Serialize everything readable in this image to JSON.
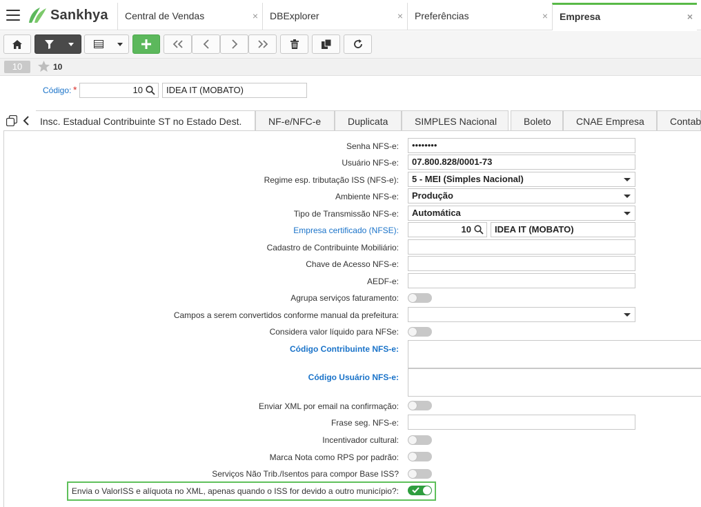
{
  "app": {
    "brand": "Sankhya",
    "tabs": [
      {
        "label": "Central de Vendas"
      },
      {
        "label": "DBExplorer"
      },
      {
        "label": "Preferências"
      },
      {
        "label": "Empresa"
      }
    ],
    "close_glyph": "×"
  },
  "toolbar": {
    "icons": [
      "home-icon",
      "filter-icon",
      "chevron-down-icon",
      "grid-icon",
      "chevron-down-icon",
      "plus-icon",
      "first-icon",
      "previous-icon",
      "next-icon",
      "last-icon",
      "trash-icon",
      "copy-icon",
      "refresh-icon"
    ]
  },
  "record": {
    "badge": "10",
    "number": "10"
  },
  "codigo": {
    "label": "Código:",
    "required": "*",
    "value": "10",
    "name": "IDEA IT (MOBATO)"
  },
  "subtabs": [
    {
      "label": "Insc. Estadual Contribuinte ST no Estado Dest."
    },
    {
      "label": "NF-e/NFC-e"
    },
    {
      "label": "Duplicata"
    },
    {
      "label": "SIMPLES Nacional"
    },
    {
      "label": "Boleto"
    },
    {
      "label": "CNAE Empresa"
    },
    {
      "label": "Contab"
    }
  ],
  "form": {
    "senha": {
      "label": "Senha NFS-e:",
      "value": "••••••••"
    },
    "usuario": {
      "label": "Usuário NFS-e:",
      "value": "07.800.828/0001-73"
    },
    "regime": {
      "label": "Regime esp. tributação ISS (NFS-e):",
      "value": "5 - MEI (Simples Nacional)"
    },
    "ambiente": {
      "label": "Ambiente NFS-e:",
      "value": "Produção"
    },
    "tipo": {
      "label": "Tipo de Transmissão NFS-e:",
      "value": "Automática"
    },
    "empresa_cert": {
      "label": "Empresa certificado (NFSE):",
      "code": "10",
      "name": "IDEA IT (MOBATO)"
    },
    "cadastro": {
      "label": "Cadastro de Contribuinte Mobiliário:",
      "value": ""
    },
    "chave": {
      "label": "Chave de Acesso NFS-e:",
      "value": ""
    },
    "aedf": {
      "label": "AEDF-e:",
      "value": ""
    },
    "agrupa": {
      "label": "Agrupa serviços faturamento:",
      "on": false
    },
    "campos": {
      "label": "Campos a serem convertidos conforme manual da prefeitura:",
      "value": ""
    },
    "considera": {
      "label": "Considera valor líquido para NFSe:",
      "on": false
    },
    "cod_contrib": {
      "label": "Código Contribuinte NFS-e:",
      "value": ""
    },
    "cod_usuario": {
      "label": "Código Usuário NFS-e:",
      "value": ""
    },
    "enviar_xml": {
      "label": "Enviar XML por email na confirmação:",
      "on": false
    },
    "frase": {
      "label": "Frase seg. NFS-e:",
      "value": ""
    },
    "incentivador": {
      "label": "Incentivador cultural:",
      "on": false
    },
    "marca_nota": {
      "label": "Marca Nota como RPS por padrão:",
      "on": false
    },
    "servicos": {
      "label": "Serviços Não Trib./Isentos para compor Base ISS?",
      "on": false
    },
    "envia_valor": {
      "label": "Envia o ValorISS e alíquota no XML, apenas quando o ISS for devido a outro município?:",
      "on": true
    }
  },
  "colors": {
    "accent": "#58b947",
    "link": "#1a73c9",
    "toggle_on": "#2e9e3e",
    "highlight": "#5ec05a"
  }
}
